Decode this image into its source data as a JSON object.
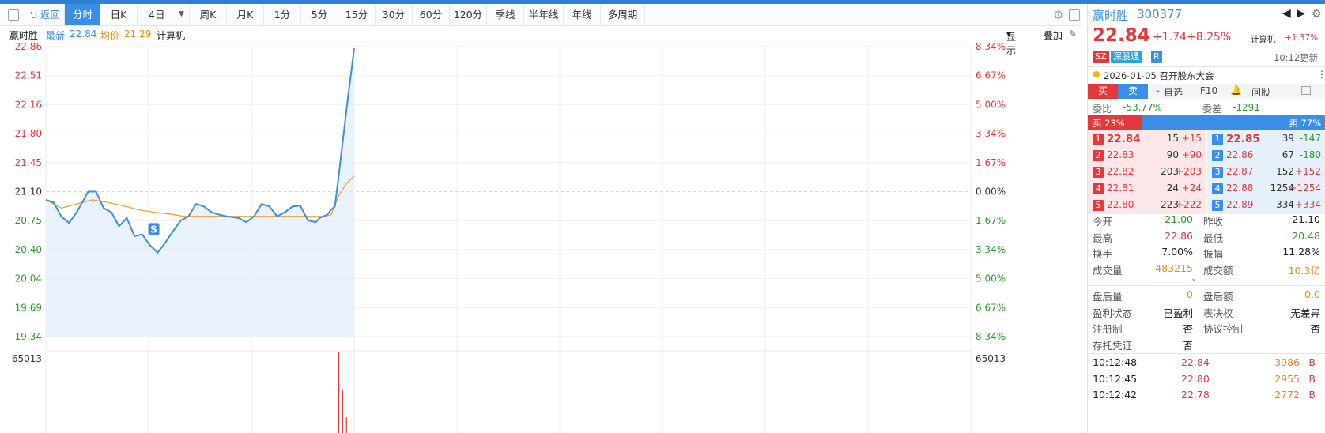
{
  "toolbar": {
    "back": "返回",
    "tabs": [
      "分时",
      "日K",
      "4日",
      "周K",
      "月K",
      "1分",
      "5分",
      "15分",
      "30分",
      "60分",
      "120分",
      "季线",
      "半年线",
      "年线",
      "多周期"
    ],
    "active": "分时"
  },
  "info": {
    "name": "赢时胜",
    "latest_label": "最新",
    "latest": "22.84",
    "avg_label": "均价",
    "avg": "21.29",
    "indicator": "计算机",
    "display": "显示",
    "overlay": "叠加"
  },
  "chart_data": {
    "type": "line",
    "title": "",
    "y_left_ticks": [
      "22.86",
      "22.51",
      "22.16",
      "21.80",
      "21.45",
      "21.10",
      "20.75",
      "20.40",
      "20.04",
      "19.69",
      "19.34"
    ],
    "y_right_ticks": [
      "8.34%",
      "6.67%",
      "5.00%",
      "3.34%",
      "1.67%",
      "0.00%",
      "1.67%",
      "3.34%",
      "5.00%",
      "6.67%",
      "8.34%"
    ],
    "ylim": [
      19.34,
      22.86
    ],
    "prev_close": 21.1,
    "total_points": 241,
    "series": [
      {
        "x": [
          0,
          2,
          4,
          6,
          8,
          11,
          13,
          15,
          17,
          19,
          21,
          23,
          25,
          27,
          29,
          31,
          33,
          35,
          37,
          39,
          41,
          43,
          45,
          47,
          50,
          52,
          54,
          56,
          58,
          60,
          62,
          64,
          66,
          68,
          70,
          71,
          72,
          73,
          74,
          75,
          76,
          78,
          80
        ],
        "values": [
          21.0,
          20.97,
          20.8,
          20.72,
          20.85,
          21.1,
          21.1,
          20.9,
          20.85,
          20.68,
          20.78,
          20.56,
          20.58,
          20.45,
          20.36,
          20.48,
          20.62,
          20.75,
          20.8,
          20.95,
          20.92,
          20.85,
          20.82,
          20.8,
          20.78,
          20.73,
          20.8,
          20.95,
          20.92,
          20.8,
          20.85,
          20.92,
          20.93,
          20.75,
          20.73,
          20.78,
          20.8,
          20.82,
          20.88,
          20.92,
          21.3,
          22.1,
          22.84
        ]
      },
      {
        "x": [
          0,
          4,
          8,
          12,
          16,
          20,
          24,
          28,
          32,
          36,
          40,
          44,
          48,
          52,
          56,
          60,
          64,
          68,
          72,
          74,
          76,
          78,
          80
        ],
        "values": [
          21.0,
          20.9,
          20.95,
          21.0,
          20.97,
          20.93,
          20.88,
          20.85,
          20.83,
          20.8,
          20.8,
          20.8,
          20.8,
          20.8,
          20.8,
          20.8,
          20.8,
          20.8,
          20.8,
          20.82,
          21.05,
          21.2,
          21.29
        ]
      }
    ],
    "volume_label": "65013",
    "volume_bars": [
      {
        "x": 76,
        "v": 65013
      },
      {
        "x": 77,
        "v": 38000
      },
      {
        "x": 78,
        "v": 18000
      }
    ],
    "marker_label": "S"
  },
  "right": {
    "name": "赢时胜",
    "code": "300377",
    "price": "22.84",
    "change": "+1.74",
    "pct": "+8.25%",
    "sector": "计算机",
    "sector_pct": "+1.37%",
    "tag_sz": "SZ",
    "tag_hk": "深股通",
    "tag_r": "R",
    "update": "10:12更新",
    "notice": "2026-01-05 召开股东大会",
    "buy": "买",
    "sell": "卖",
    "watch": "自选",
    "f10": "F10",
    "ask": "问股",
    "weibi_label": "委比",
    "weibi": "-53.77%",
    "weicha_label": "委差",
    "weicha": "-1291",
    "buy_pct": "买 23%",
    "sell_pct": "卖 77%",
    "buy_ratio": 0.23,
    "bids": [
      {
        "n": "1",
        "p": "22.84",
        "q": "15",
        "c": "+15"
      },
      {
        "n": "2",
        "p": "22.83",
        "q": "90",
        "c": "+90"
      },
      {
        "n": "3",
        "p": "22.82",
        "q": "203",
        "c": "+203"
      },
      {
        "n": "4",
        "p": "22.81",
        "q": "24",
        "c": "+24"
      },
      {
        "n": "5",
        "p": "22.80",
        "q": "223",
        "c": "+222"
      }
    ],
    "asks": [
      {
        "n": "1",
        "p": "22.85",
        "q": "39",
        "c": "-147"
      },
      {
        "n": "2",
        "p": "22.86",
        "q": "67",
        "c": "-180"
      },
      {
        "n": "3",
        "p": "22.87",
        "q": "152",
        "c": "+152"
      },
      {
        "n": "4",
        "p": "22.88",
        "q": "1254",
        "c": "+1254"
      },
      {
        "n": "5",
        "p": "22.89",
        "q": "334",
        "c": "+334"
      }
    ],
    "stats": [
      {
        "l1": "今开",
        "v1": "21.00",
        "c1": "green",
        "l2": "昨收",
        "v2": "21.10",
        "c2": "dark"
      },
      {
        "l1": "最高",
        "v1": "22.86",
        "c1": "red",
        "l2": "最低",
        "v2": "20.48",
        "c2": "green"
      },
      {
        "l1": "换手",
        "v1": "7.00%",
        "c1": "dark",
        "l2": "振幅",
        "v2": "11.28%",
        "c2": "dark"
      },
      {
        "l1": "成交量",
        "v1": "483215",
        "c1": "orange",
        "l2": "成交额",
        "v2": "10.3亿",
        "c2": "orange"
      }
    ],
    "stats2": [
      {
        "l1": "盘后量",
        "v1": "0",
        "c1": "orange",
        "l2": "盘后额",
        "v2": "0.0",
        "c2": "orange"
      },
      {
        "l1": "盈利状态",
        "v1": "已盈利",
        "c1": "dark",
        "l2": "表决权",
        "v2": "无差异",
        "c2": "dark"
      },
      {
        "l1": "注册制",
        "v1": "否",
        "c1": "dark",
        "l2": "协议控制",
        "v2": "否",
        "c2": "dark"
      },
      {
        "l1": "存托凭证",
        "v1": "否",
        "c1": "dark",
        "l2": "",
        "v2": "",
        "c2": "dark"
      }
    ],
    "ticks": [
      {
        "t": "10:12:48",
        "p": "22.84",
        "v": "3986",
        "d": "B"
      },
      {
        "t": "10:12:45",
        "p": "22.80",
        "v": "2955",
        "d": "B"
      },
      {
        "t": "10:12:42",
        "p": "22.78",
        "v": "2772",
        "d": "B"
      }
    ]
  }
}
